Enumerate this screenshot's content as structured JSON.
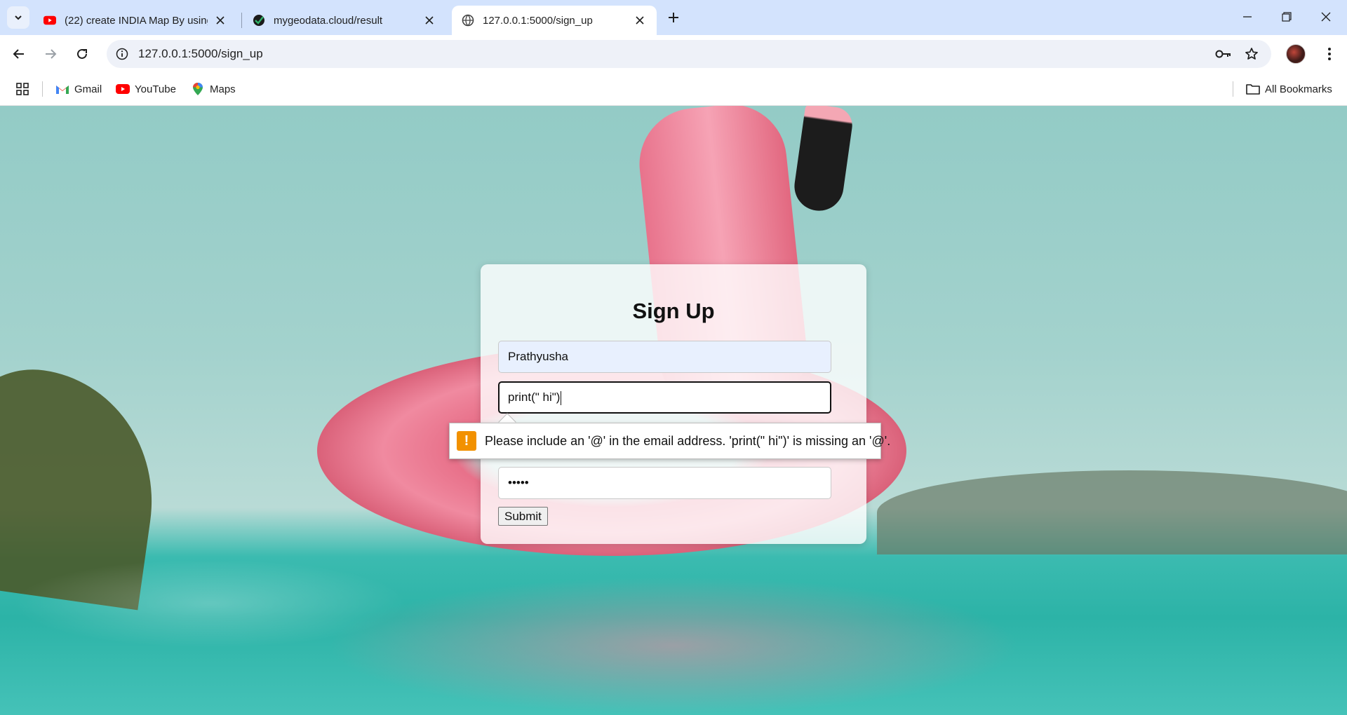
{
  "browser": {
    "tabs": [
      {
        "title": "(22) create INDIA Map By using",
        "icon": "youtube-icon",
        "active": false
      },
      {
        "title": "mygeodata.cloud/result",
        "icon": "mygeodata-icon",
        "active": false
      },
      {
        "title": "127.0.0.1:5000/sign_up",
        "icon": "globe-icon",
        "active": true
      }
    ],
    "url": "127.0.0.1:5000/sign_up",
    "bookmarks": [
      {
        "label": "Gmail",
        "icon": "gmail-icon"
      },
      {
        "label": "YouTube",
        "icon": "youtube-icon"
      },
      {
        "label": "Maps",
        "icon": "maps-icon"
      }
    ],
    "all_bookmarks_label": "All Bookmarks"
  },
  "page": {
    "heading": "Sign Up",
    "name_value": "Prathyusha",
    "email_value": "print(\" hi\")",
    "password_value": "•••••",
    "submit_label": "Submit",
    "validation_message": "Please include an '@' in the email address. 'print(\" hi\")' is missing an '@'.",
    "validation_icon": "!"
  },
  "colors": {
    "tabstrip": "#d3e3fd",
    "warning": "#f29100",
    "autofill": "#e8f0fe"
  }
}
